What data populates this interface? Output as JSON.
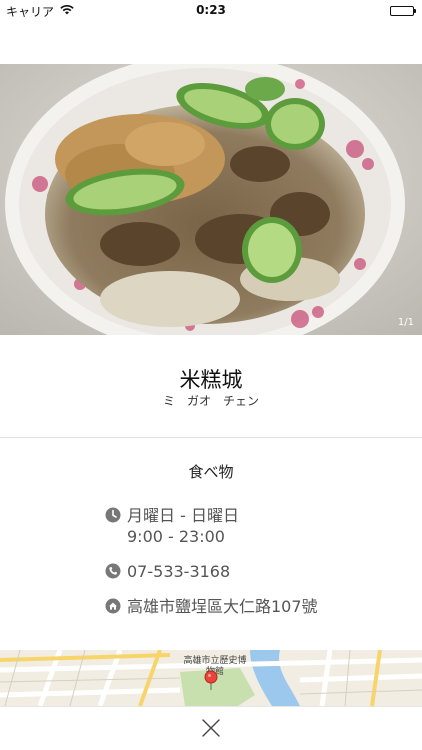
{
  "status": {
    "carrier": "キャリア",
    "time": "0:23",
    "battery_level": 1.0
  },
  "photo": {
    "counter": "1/1"
  },
  "place": {
    "name": "米糕城",
    "reading": "ミ　ガオ　チェン",
    "category": "食べ物",
    "hours_days": "月曜日 - 日曜日",
    "hours_time": "9:00 - 23:00",
    "phone": "07-533-3168",
    "address": "高雄市鹽埕區大仁路107號"
  },
  "map": {
    "poi_label": "高雄市立歷史博物館"
  },
  "icons": {
    "hours": "clock-icon",
    "phone": "phone-icon",
    "address": "home-icon",
    "close": "close-icon",
    "map_pin": "map-pin-icon",
    "wifi": "wifi-icon",
    "battery": "battery-icon"
  },
  "colors": {
    "icon_gray": "#777777",
    "pin_red": "#e8443a",
    "map_road": "#ffffff",
    "map_water": "#9cc8ee",
    "map_park": "#c8dfae"
  }
}
